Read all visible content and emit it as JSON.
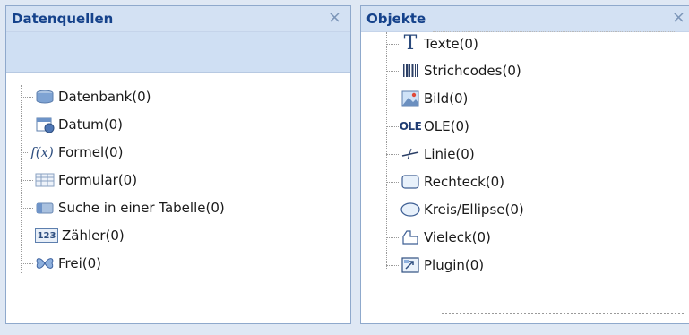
{
  "left_panel": {
    "title": "Datenquellen",
    "close_symbol": "×",
    "items": [
      {
        "label": "Datenbank(0)",
        "icon": "database-icon"
      },
      {
        "label": "Datum(0)",
        "icon": "calendar-icon"
      },
      {
        "label": "Formel(0)",
        "icon": "formula-icon"
      },
      {
        "label": "Formular(0)",
        "icon": "form-icon"
      },
      {
        "label": "Suche in einer Tabelle(0)",
        "icon": "table-lookup-icon"
      },
      {
        "label": "Zähler(0)",
        "icon": "counter-icon"
      },
      {
        "label": "Frei(0)",
        "icon": "free-icon"
      }
    ]
  },
  "right_panel": {
    "title": "Objekte",
    "close_symbol": "×",
    "items": [
      {
        "label": "Texte(0)",
        "icon": "text-icon"
      },
      {
        "label": "Strichcodes(0)",
        "icon": "barcode-icon"
      },
      {
        "label": "Bild(0)",
        "icon": "image-icon"
      },
      {
        "label": "OLE(0)",
        "icon": "ole-icon"
      },
      {
        "label": "Linie(0)",
        "icon": "line-icon"
      },
      {
        "label": "Rechteck(0)",
        "icon": "rectangle-icon"
      },
      {
        "label": "Kreis/Ellipse(0)",
        "icon": "ellipse-icon"
      },
      {
        "label": "Vieleck(0)",
        "icon": "polygon-icon"
      },
      {
        "label": "Plugin(0)",
        "icon": "plugin-icon"
      }
    ]
  },
  "icon_glyphs": {
    "formula": "f(x)",
    "ole": "OLE",
    "counter": "123",
    "text": "T"
  },
  "colors": {
    "header_bg": "#d3e1f3",
    "title_color": "#15428b",
    "border": "#8fa9cc"
  }
}
